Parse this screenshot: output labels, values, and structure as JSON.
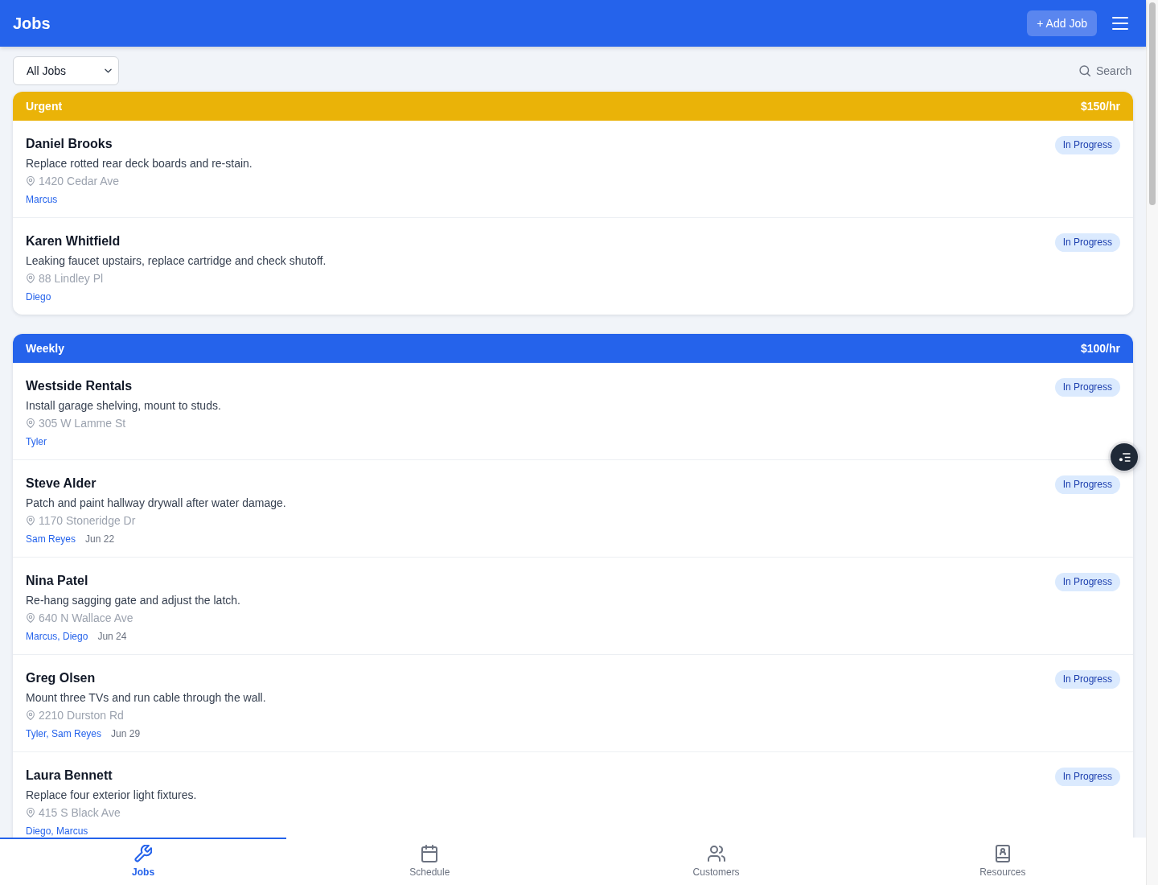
{
  "header": {
    "title": "Jobs",
    "add_button": "+ Add Job"
  },
  "toolbar": {
    "filter": "All Jobs",
    "search": {
      "placeholder": "Search"
    }
  },
  "groups": [
    {
      "name": "Urgent",
      "rate": "$150/hr",
      "color": "#eab308",
      "jobs": [
        {
          "customer": "Daniel Brooks",
          "description": "Replace rotted rear deck boards and re-stain.",
          "address": "1420 Cedar Ave",
          "assignees": "Marcus",
          "status": "In Progress"
        },
        {
          "customer": "Karen Whitfield",
          "description": "Leaking faucet upstairs, replace cartridge and check shutoff.",
          "address": "88 Lindley Pl",
          "assignees": "Diego",
          "status": "In Progress"
        }
      ]
    },
    {
      "name": "Weekly",
      "rate": "$100/hr",
      "color": "#2563eb",
      "jobs": [
        {
          "customer": "Westside Rentals",
          "description": "Install garage shelving, mount to studs.",
          "address": "305 W Lamme St",
          "assignees": "Tyler",
          "status": "In Progress"
        },
        {
          "customer": "Steve Alder",
          "description": "Patch and paint hallway drywall after water damage.",
          "address": "1170 Stoneridge Dr",
          "assignees": "Sam Reyes",
          "date": "Jun 22",
          "status": "In Progress"
        },
        {
          "customer": "Nina Patel",
          "description": "Re-hang sagging gate and adjust the latch.",
          "address": "640 N Wallace Ave",
          "assignees": "Marcus, Diego",
          "date": "Jun 24",
          "status": "In Progress"
        },
        {
          "customer": "Greg Olsen",
          "description": "Mount three TVs and run cable through the wall.",
          "address": "2210 Durston Rd",
          "assignees": "Tyler, Sam Reyes",
          "date": "Jun 29",
          "status": "In Progress"
        },
        {
          "customer": "Laura Bennett",
          "description": "Replace four exterior light fixtures.",
          "address": "415 S Black Ave",
          "assignees": "Diego, Marcus",
          "status": "In Progress"
        }
      ]
    }
  ],
  "nav": [
    {
      "label": "Jobs",
      "selected": true
    },
    {
      "label": "Schedule",
      "selected": false
    },
    {
      "label": "Customers",
      "selected": false
    },
    {
      "label": "Resources",
      "selected": false
    }
  ]
}
